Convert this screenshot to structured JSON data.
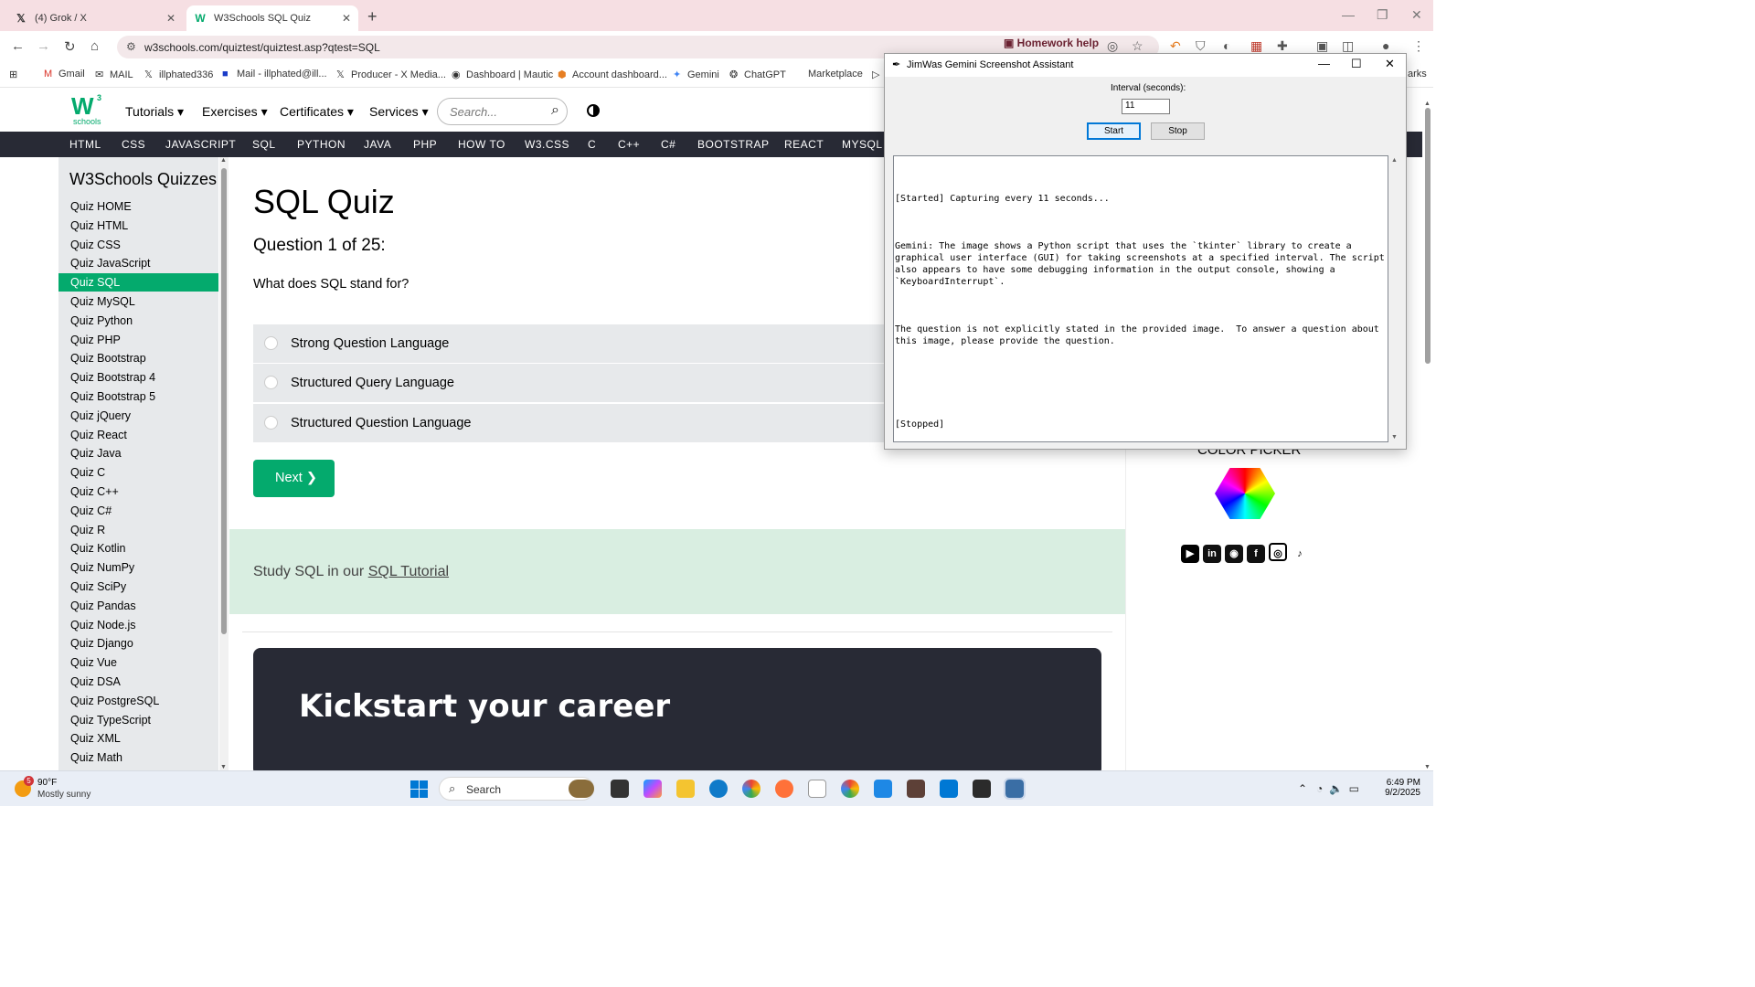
{
  "browser": {
    "tabs": [
      {
        "label": "(4) Grok / X",
        "icon": "x-logo-icon"
      },
      {
        "label": "W3Schools SQL Quiz",
        "icon": "w3schools-icon"
      }
    ],
    "url": "w3schools.com/quiztest/quiztest.asp?qtest=SQL",
    "homework_help": "Homework help",
    "bookmarks": [
      "Gmail",
      "MAIL",
      "illphated336",
      "Mail - illphated@ill...",
      "Producer - X Media...",
      "Dashboard | Mautic",
      "Account dashboard...",
      "Gemini",
      "ChatGPT",
      "Marketplace"
    ],
    "bookmarks_overflow": "arks"
  },
  "w3": {
    "logo_letter": "W",
    "logo_sup": "3",
    "logo_sub": "schools",
    "menu": [
      "Tutorials",
      "Exercises",
      "Certificates",
      "Services"
    ],
    "search_placeholder": "Search...",
    "topnav": [
      "HTML",
      "CSS",
      "JAVASCRIPT",
      "SQL",
      "PYTHON",
      "JAVA",
      "PHP",
      "HOW TO",
      "W3.CSS",
      "C",
      "C++",
      "C#",
      "BOOTSTRAP",
      "REACT",
      "MYSQL"
    ]
  },
  "sidebar": {
    "title": "W3Schools Quizzes",
    "items": [
      "Quiz HOME",
      "Quiz HTML",
      "Quiz CSS",
      "Quiz JavaScript",
      "Quiz SQL",
      "Quiz MySQL",
      "Quiz Python",
      "Quiz PHP",
      "Quiz Bootstrap",
      "Quiz Bootstrap 4",
      "Quiz Bootstrap 5",
      "Quiz jQuery",
      "Quiz React",
      "Quiz Java",
      "Quiz C",
      "Quiz C++",
      "Quiz C#",
      "Quiz R",
      "Quiz Kotlin",
      "Quiz NumPy",
      "Quiz SciPy",
      "Quiz Pandas",
      "Quiz Node.js",
      "Quiz Django",
      "Quiz Vue",
      "Quiz DSA",
      "Quiz PostgreSQL",
      "Quiz TypeScript",
      "Quiz XML",
      "Quiz Math"
    ],
    "active": "Quiz SQL"
  },
  "quiz": {
    "title": "SQL Quiz",
    "question_number": "Question 1 of 25:",
    "question": "What does SQL stand for?",
    "options": [
      "Strong Question Language",
      "Structured Query Language",
      "Structured Question Language"
    ],
    "next_label": "Next ❯",
    "study_prefix": "Study SQL in our ",
    "study_link": "SQL Tutorial",
    "career_heading": "Kickstart your career"
  },
  "right": {
    "color_picker_label": "COLOR PICKER",
    "socials": [
      "youtube-icon",
      "linkedin-icon",
      "discord-icon",
      "facebook-icon",
      "instagram-icon",
      "tiktok-icon"
    ]
  },
  "dialog": {
    "title": "JimWas Gemini Screenshot Assistant",
    "interval_label": "Interval (seconds):",
    "interval_value": "11",
    "start_label": "Start",
    "stop_label": "Stop",
    "log": [
      "[Started] Capturing every 11 seconds...",
      "Gemini: The image shows a Python script that uses the `tkinter` library to create a graphical user interface (GUI) for taking screenshots at a specified interval. The script also appears to have some debugging information in the output console, showing a `KeyboardInterrupt`.",
      "The question is not explicitly stated in the provided image.  To answer a question about this image, please provide the question.",
      "",
      "[Stopped]"
    ]
  },
  "taskbar": {
    "weather_badge": "5",
    "temperature": "90°F",
    "condition": "Mostly sunny",
    "search_label": "Search",
    "time": "6:49 PM",
    "date": "9/2/2025"
  }
}
